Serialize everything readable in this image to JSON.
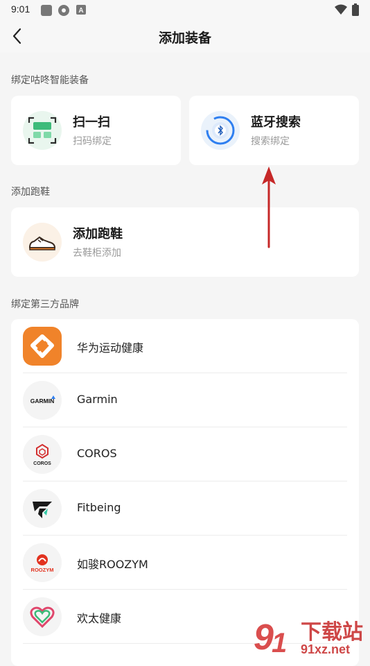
{
  "status_bar": {
    "time": "9:01"
  },
  "header": {
    "title": "添加装备"
  },
  "sections": {
    "bind_device": "绑定咕咚智能装备",
    "add_shoes": "添加跑鞋",
    "third_party": "绑定第三方品牌"
  },
  "cards": {
    "scan": {
      "title": "扫一扫",
      "subtitle": "扫码绑定"
    },
    "bluetooth": {
      "title": "蓝牙搜索",
      "subtitle": "搜索绑定"
    },
    "shoes": {
      "title": "添加跑鞋",
      "subtitle": "去鞋柜添加"
    }
  },
  "brands": [
    {
      "name": "华为运动健康"
    },
    {
      "name": "Garmin",
      "logo_text": "GARMIN"
    },
    {
      "name": "COROS",
      "logo_text": "COROS"
    },
    {
      "name": "Fitbeing"
    },
    {
      "name": "如骏ROOZYM",
      "logo_text": "ROOZYM"
    },
    {
      "name": "欢太健康"
    }
  ],
  "watermark": {
    "text_cn": "下载站",
    "text_url": "91xz.net"
  },
  "colors": {
    "accent_red": "#d32f2f",
    "huawei_orange": "#f0832a",
    "scan_green": "#3dbb7a",
    "bluetooth_blue": "#2f7ff0"
  }
}
